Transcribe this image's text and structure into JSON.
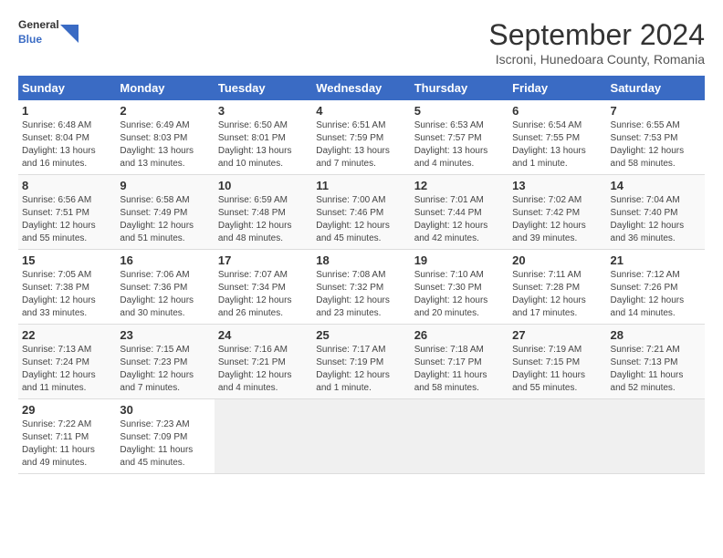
{
  "logo": {
    "line1": "General",
    "line2": "Blue"
  },
  "title": "September 2024",
  "subtitle": "Iscroni, Hunedoara County, Romania",
  "headers": [
    "Sunday",
    "Monday",
    "Tuesday",
    "Wednesday",
    "Thursday",
    "Friday",
    "Saturday"
  ],
  "weeks": [
    [
      {
        "day": "1",
        "info": "Sunrise: 6:48 AM\nSunset: 8:04 PM\nDaylight: 13 hours\nand 16 minutes."
      },
      {
        "day": "2",
        "info": "Sunrise: 6:49 AM\nSunset: 8:03 PM\nDaylight: 13 hours\nand 13 minutes."
      },
      {
        "day": "3",
        "info": "Sunrise: 6:50 AM\nSunset: 8:01 PM\nDaylight: 13 hours\nand 10 minutes."
      },
      {
        "day": "4",
        "info": "Sunrise: 6:51 AM\nSunset: 7:59 PM\nDaylight: 13 hours\nand 7 minutes."
      },
      {
        "day": "5",
        "info": "Sunrise: 6:53 AM\nSunset: 7:57 PM\nDaylight: 13 hours\nand 4 minutes."
      },
      {
        "day": "6",
        "info": "Sunrise: 6:54 AM\nSunset: 7:55 PM\nDaylight: 13 hours\nand 1 minute."
      },
      {
        "day": "7",
        "info": "Sunrise: 6:55 AM\nSunset: 7:53 PM\nDaylight: 12 hours\nand 58 minutes."
      }
    ],
    [
      {
        "day": "8",
        "info": "Sunrise: 6:56 AM\nSunset: 7:51 PM\nDaylight: 12 hours\nand 55 minutes."
      },
      {
        "day": "9",
        "info": "Sunrise: 6:58 AM\nSunset: 7:49 PM\nDaylight: 12 hours\nand 51 minutes."
      },
      {
        "day": "10",
        "info": "Sunrise: 6:59 AM\nSunset: 7:48 PM\nDaylight: 12 hours\nand 48 minutes."
      },
      {
        "day": "11",
        "info": "Sunrise: 7:00 AM\nSunset: 7:46 PM\nDaylight: 12 hours\nand 45 minutes."
      },
      {
        "day": "12",
        "info": "Sunrise: 7:01 AM\nSunset: 7:44 PM\nDaylight: 12 hours\nand 42 minutes."
      },
      {
        "day": "13",
        "info": "Sunrise: 7:02 AM\nSunset: 7:42 PM\nDaylight: 12 hours\nand 39 minutes."
      },
      {
        "day": "14",
        "info": "Sunrise: 7:04 AM\nSunset: 7:40 PM\nDaylight: 12 hours\nand 36 minutes."
      }
    ],
    [
      {
        "day": "15",
        "info": "Sunrise: 7:05 AM\nSunset: 7:38 PM\nDaylight: 12 hours\nand 33 minutes."
      },
      {
        "day": "16",
        "info": "Sunrise: 7:06 AM\nSunset: 7:36 PM\nDaylight: 12 hours\nand 30 minutes."
      },
      {
        "day": "17",
        "info": "Sunrise: 7:07 AM\nSunset: 7:34 PM\nDaylight: 12 hours\nand 26 minutes."
      },
      {
        "day": "18",
        "info": "Sunrise: 7:08 AM\nSunset: 7:32 PM\nDaylight: 12 hours\nand 23 minutes."
      },
      {
        "day": "19",
        "info": "Sunrise: 7:10 AM\nSunset: 7:30 PM\nDaylight: 12 hours\nand 20 minutes."
      },
      {
        "day": "20",
        "info": "Sunrise: 7:11 AM\nSunset: 7:28 PM\nDaylight: 12 hours\nand 17 minutes."
      },
      {
        "day": "21",
        "info": "Sunrise: 7:12 AM\nSunset: 7:26 PM\nDaylight: 12 hours\nand 14 minutes."
      }
    ],
    [
      {
        "day": "22",
        "info": "Sunrise: 7:13 AM\nSunset: 7:24 PM\nDaylight: 12 hours\nand 11 minutes."
      },
      {
        "day": "23",
        "info": "Sunrise: 7:15 AM\nSunset: 7:23 PM\nDaylight: 12 hours\nand 7 minutes."
      },
      {
        "day": "24",
        "info": "Sunrise: 7:16 AM\nSunset: 7:21 PM\nDaylight: 12 hours\nand 4 minutes."
      },
      {
        "day": "25",
        "info": "Sunrise: 7:17 AM\nSunset: 7:19 PM\nDaylight: 12 hours\nand 1 minute."
      },
      {
        "day": "26",
        "info": "Sunrise: 7:18 AM\nSunset: 7:17 PM\nDaylight: 11 hours\nand 58 minutes."
      },
      {
        "day": "27",
        "info": "Sunrise: 7:19 AM\nSunset: 7:15 PM\nDaylight: 11 hours\nand 55 minutes."
      },
      {
        "day": "28",
        "info": "Sunrise: 7:21 AM\nSunset: 7:13 PM\nDaylight: 11 hours\nand 52 minutes."
      }
    ],
    [
      {
        "day": "29",
        "info": "Sunrise: 7:22 AM\nSunset: 7:11 PM\nDaylight: 11 hours\nand 49 minutes."
      },
      {
        "day": "30",
        "info": "Sunrise: 7:23 AM\nSunset: 7:09 PM\nDaylight: 11 hours\nand 45 minutes."
      },
      {
        "day": "",
        "info": ""
      },
      {
        "day": "",
        "info": ""
      },
      {
        "day": "",
        "info": ""
      },
      {
        "day": "",
        "info": ""
      },
      {
        "day": "",
        "info": ""
      }
    ]
  ]
}
